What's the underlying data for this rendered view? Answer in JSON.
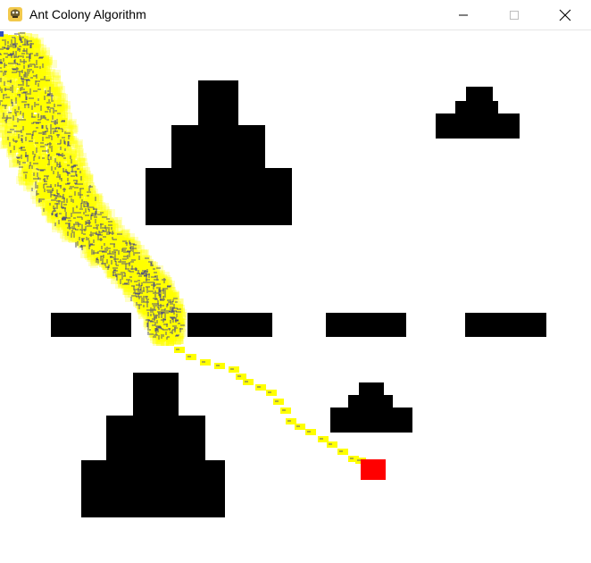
{
  "window": {
    "title": "Ant Colony Algorithm",
    "app_icon": "python-snake-icon",
    "controls": [
      "minimize-icon",
      "maximize-icon",
      "close-icon"
    ]
  },
  "simulation": {
    "colors": {
      "obstacle": "#000000",
      "pheromone": "#ffff00",
      "ant": "#5a5a78",
      "food": "#ff0000",
      "nest_marker": "#3050c0",
      "background": "#ffffff"
    },
    "legend_text": []
  }
}
